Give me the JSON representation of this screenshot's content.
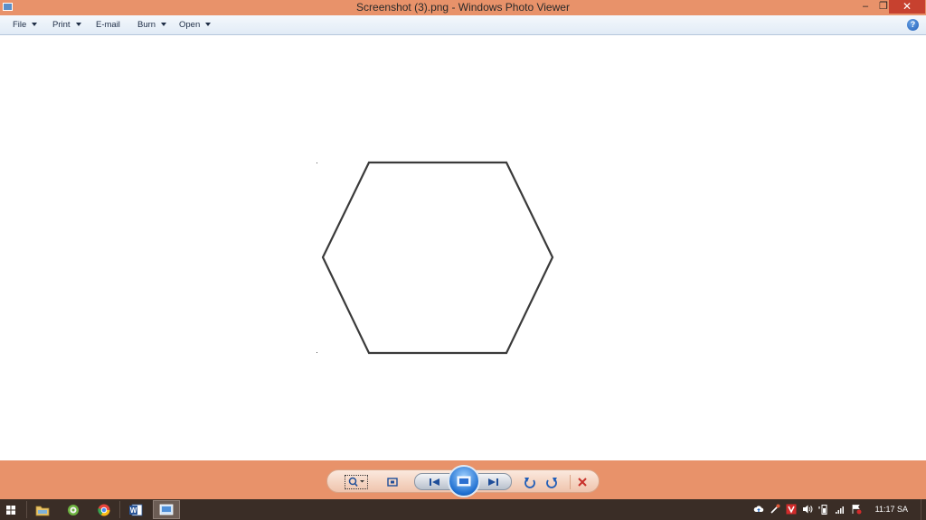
{
  "window": {
    "title": "Screenshot (3).png - Windows Photo Viewer",
    "minimize": "–",
    "restore": "❐",
    "close": "✕"
  },
  "menu": {
    "items": [
      {
        "label": "File",
        "has_arrow": true
      },
      {
        "label": "Print",
        "has_arrow": true
      },
      {
        "label": "E-mail",
        "has_arrow": false
      },
      {
        "label": "Burn",
        "has_arrow": true
      },
      {
        "label": "Open",
        "has_arrow": true
      }
    ],
    "help": "?"
  },
  "image": {
    "shape": "hexagon",
    "stroke_color": "#3a3a3a",
    "background": "#ffffff"
  },
  "controls": {
    "zoom": "zoom-icon",
    "actual_size": "actual-size-icon",
    "previous": "previous-icon",
    "slideshow": "slideshow-icon",
    "next": "next-icon",
    "rotate_ccw": "rotate-counterclockwise-icon",
    "rotate_cw": "rotate-clockwise-icon",
    "delete": "delete-icon"
  },
  "taskbar": {
    "clock": "11:17 SA",
    "apps": [
      "file-explorer",
      "media-app",
      "chrome",
      "word",
      "photo-viewer"
    ]
  },
  "colors": {
    "accent": "#e8926a",
    "taskbar": "#3a2d26",
    "menubar": "#e1ebf6",
    "close": "#c7412f"
  }
}
